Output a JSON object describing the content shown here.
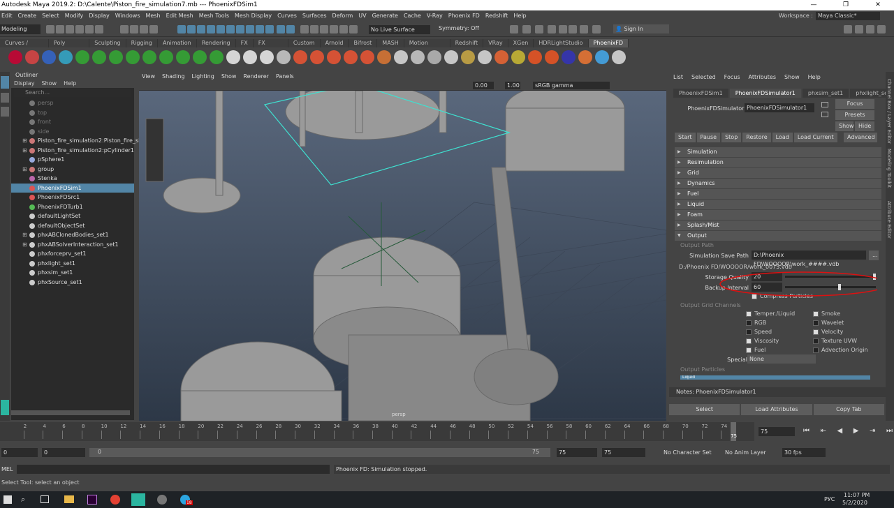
{
  "titlebar": {
    "title": "Autodesk Maya 2019.2: D:\\Calente\\Piston_fire_simulation7.mb  ---  PhoenixFDSim1",
    "min": "—",
    "max": "❐",
    "close": "✕"
  },
  "menubar": [
    "Edit",
    "Create",
    "Select",
    "Modify",
    "Display",
    "Windows",
    "Mesh",
    "Edit Mesh",
    "Mesh Tools",
    "Mesh Display",
    "Curves",
    "Surfaces",
    "Deform",
    "UV",
    "Generate",
    "Cache",
    "V-Ray",
    "Phoenix FD",
    "Redshift",
    "Help"
  ],
  "workspace": {
    "label": "Workspace :",
    "value": "Maya Classic*"
  },
  "statusline": {
    "mode": "Modeling",
    "live_surface": "No Live Surface",
    "symmetry": "Symmetry: Off",
    "signin": "Sign In"
  },
  "shelf_tabs": [
    "Curves / Surfaces",
    "Poly Modeling",
    "Sculpting",
    "Rigging",
    "Animation",
    "Rendering",
    "FX",
    "FX Caching",
    "Custom",
    "Arnold",
    "Bifrost",
    "MASH",
    "Motion Graphics",
    "Redshift",
    "VRay",
    "XGen",
    "HDRLightStudio",
    "PhoenixFD"
  ],
  "outliner": {
    "title": "Outliner",
    "menu": [
      "Display",
      "Show",
      "Help"
    ],
    "search_placeholder": "Search...",
    "rows": [
      {
        "label": "persp",
        "dim": true,
        "color": "#777"
      },
      {
        "label": "top",
        "dim": true,
        "color": "#777"
      },
      {
        "label": "front",
        "dim": true,
        "color": "#777"
      },
      {
        "label": "side",
        "dim": true,
        "color": "#777"
      },
      {
        "label": "Piston_fire_simulation2:Piston_fire_si",
        "color": "#c77"
      },
      {
        "label": "Piston_fire_simulation2:pCylinder1",
        "color": "#c77"
      },
      {
        "label": "pSphere1",
        "color": "#9ad"
      },
      {
        "label": "group",
        "color": "#c77"
      },
      {
        "label": "Stenka",
        "color": "#b6a"
      },
      {
        "label": "PhoenixFDSim1",
        "color": "#d55",
        "sel": true
      },
      {
        "label": "PhoenixFDSrc1",
        "color": "#d55"
      },
      {
        "label": "PhoenixFDTurb1",
        "color": "#5b5"
      },
      {
        "label": "defaultLightSet",
        "color": "#ccc"
      },
      {
        "label": "defaultObjectSet",
        "color": "#ccc"
      },
      {
        "label": "phxABClonedBodies_set1",
        "color": "#ccc"
      },
      {
        "label": "phxABSolverInteraction_set1",
        "color": "#ccc"
      },
      {
        "label": "phxforceprv_set1",
        "color": "#ccc"
      },
      {
        "label": "phxlight_set1",
        "color": "#ccc"
      },
      {
        "label": "phxsim_set1",
        "color": "#ccc"
      },
      {
        "label": "phxSource_set1",
        "color": "#ccc"
      }
    ]
  },
  "viewport": {
    "menu": [
      "View",
      "Shading",
      "Lighting",
      "Show",
      "Renderer",
      "Panels"
    ],
    "value1": "0.00",
    "value2": "1.00",
    "colorspace": "sRGB gamma",
    "camera": "persp"
  },
  "attribute_editor": {
    "menu": [
      "List",
      "Selected",
      "Focus",
      "Attributes",
      "Show",
      "Help"
    ],
    "tabs": [
      "PhoenixFDSim1",
      "PhoenixFDSimulator1",
      "phxsim_set1",
      "phxlight_set1"
    ],
    "node_label": "PhoenixFDSimulator:",
    "node_value": "PhoenixFDSimulator1",
    "focus": "Focus",
    "presets": "Presets",
    "show": "Show",
    "hide": "Hide",
    "buttons": [
      "Start",
      "Pause",
      "Stop",
      "Restore",
      "Load",
      "Load Current"
    ],
    "advanced": "Advanced",
    "sections": [
      "Simulation",
      "Resimulation",
      "Grid",
      "Dynamics",
      "Fuel",
      "Liquid",
      "Foam",
      "Splash/Mist",
      "Output"
    ],
    "output": {
      "path_group": "Output Path",
      "save_path_label": "Simulation Save Path",
      "save_path_value": "D:\\Phoenix FD\\WOOOOR\\work_####.vdb",
      "browse": "...",
      "resolved_path": "D:/Phoenix FD/WOOOOR/work_0075.vdb",
      "storage_quality_label": "Storage Quality",
      "storage_quality_value": "20",
      "storage_quality_fraction": 1.0,
      "backup_interval_label": "Backup Interval",
      "backup_interval_value": "60",
      "backup_interval_fraction": 0.6,
      "compress_label": "Compress Particles",
      "grid_channels_group": "Output Grid Channels",
      "channels_left": [
        {
          "label": "Temper./Liquid",
          "on": true
        },
        {
          "label": "RGB",
          "on": false
        },
        {
          "label": "Speed",
          "on": false
        },
        {
          "label": "Viscosity",
          "on": true
        },
        {
          "label": "Fuel",
          "on": true
        }
      ],
      "channels_right": [
        {
          "label": "Smoke",
          "on": true
        },
        {
          "label": "Wavelet",
          "on": false
        },
        {
          "label": "Velocity",
          "on": true
        },
        {
          "label": "Texture UVW",
          "on": false
        },
        {
          "label": "Advection Origin",
          "on": false
        }
      ],
      "special_label": "Special",
      "special_value": "None",
      "particles_group": "Output Particles",
      "particles_item": "Liquid"
    },
    "notes": "Notes:  PhoenixFDSimulator1",
    "bottom_buttons": [
      "Select",
      "Load Attributes",
      "Copy Tab"
    ]
  },
  "side_tabs": [
    "Channel Box / Layer Editor",
    "Modeling Toolkit",
    "Attribute Editor"
  ],
  "timeline": {
    "ticks": [
      "2",
      "4",
      "6",
      "8",
      "10",
      "12",
      "14",
      "16",
      "18",
      "20",
      "22",
      "24",
      "26",
      "28",
      "30",
      "32",
      "34",
      "36",
      "38",
      "40",
      "42",
      "44",
      "46",
      "48",
      "50",
      "52",
      "54",
      "56",
      "58",
      "60",
      "62",
      "64",
      "66",
      "68",
      "70",
      "72",
      "74"
    ],
    "current": "75",
    "current_field": "75"
  },
  "range": {
    "start": "0",
    "range_start": "0",
    "range_end": "75",
    "end_a": "75",
    "end_b": "75",
    "character_set": "No Character Set",
    "anim_layer": "No Anim Layer",
    "fps": "30 fps"
  },
  "cmdline": {
    "lang": "MEL",
    "result": "Phoenix FD: Simulation stopped."
  },
  "helpline": "Select Tool: select an object",
  "taskbar": {
    "lang": "РУС",
    "time": "11:07 PM",
    "date": "5/2/2020",
    "badge": "18"
  }
}
